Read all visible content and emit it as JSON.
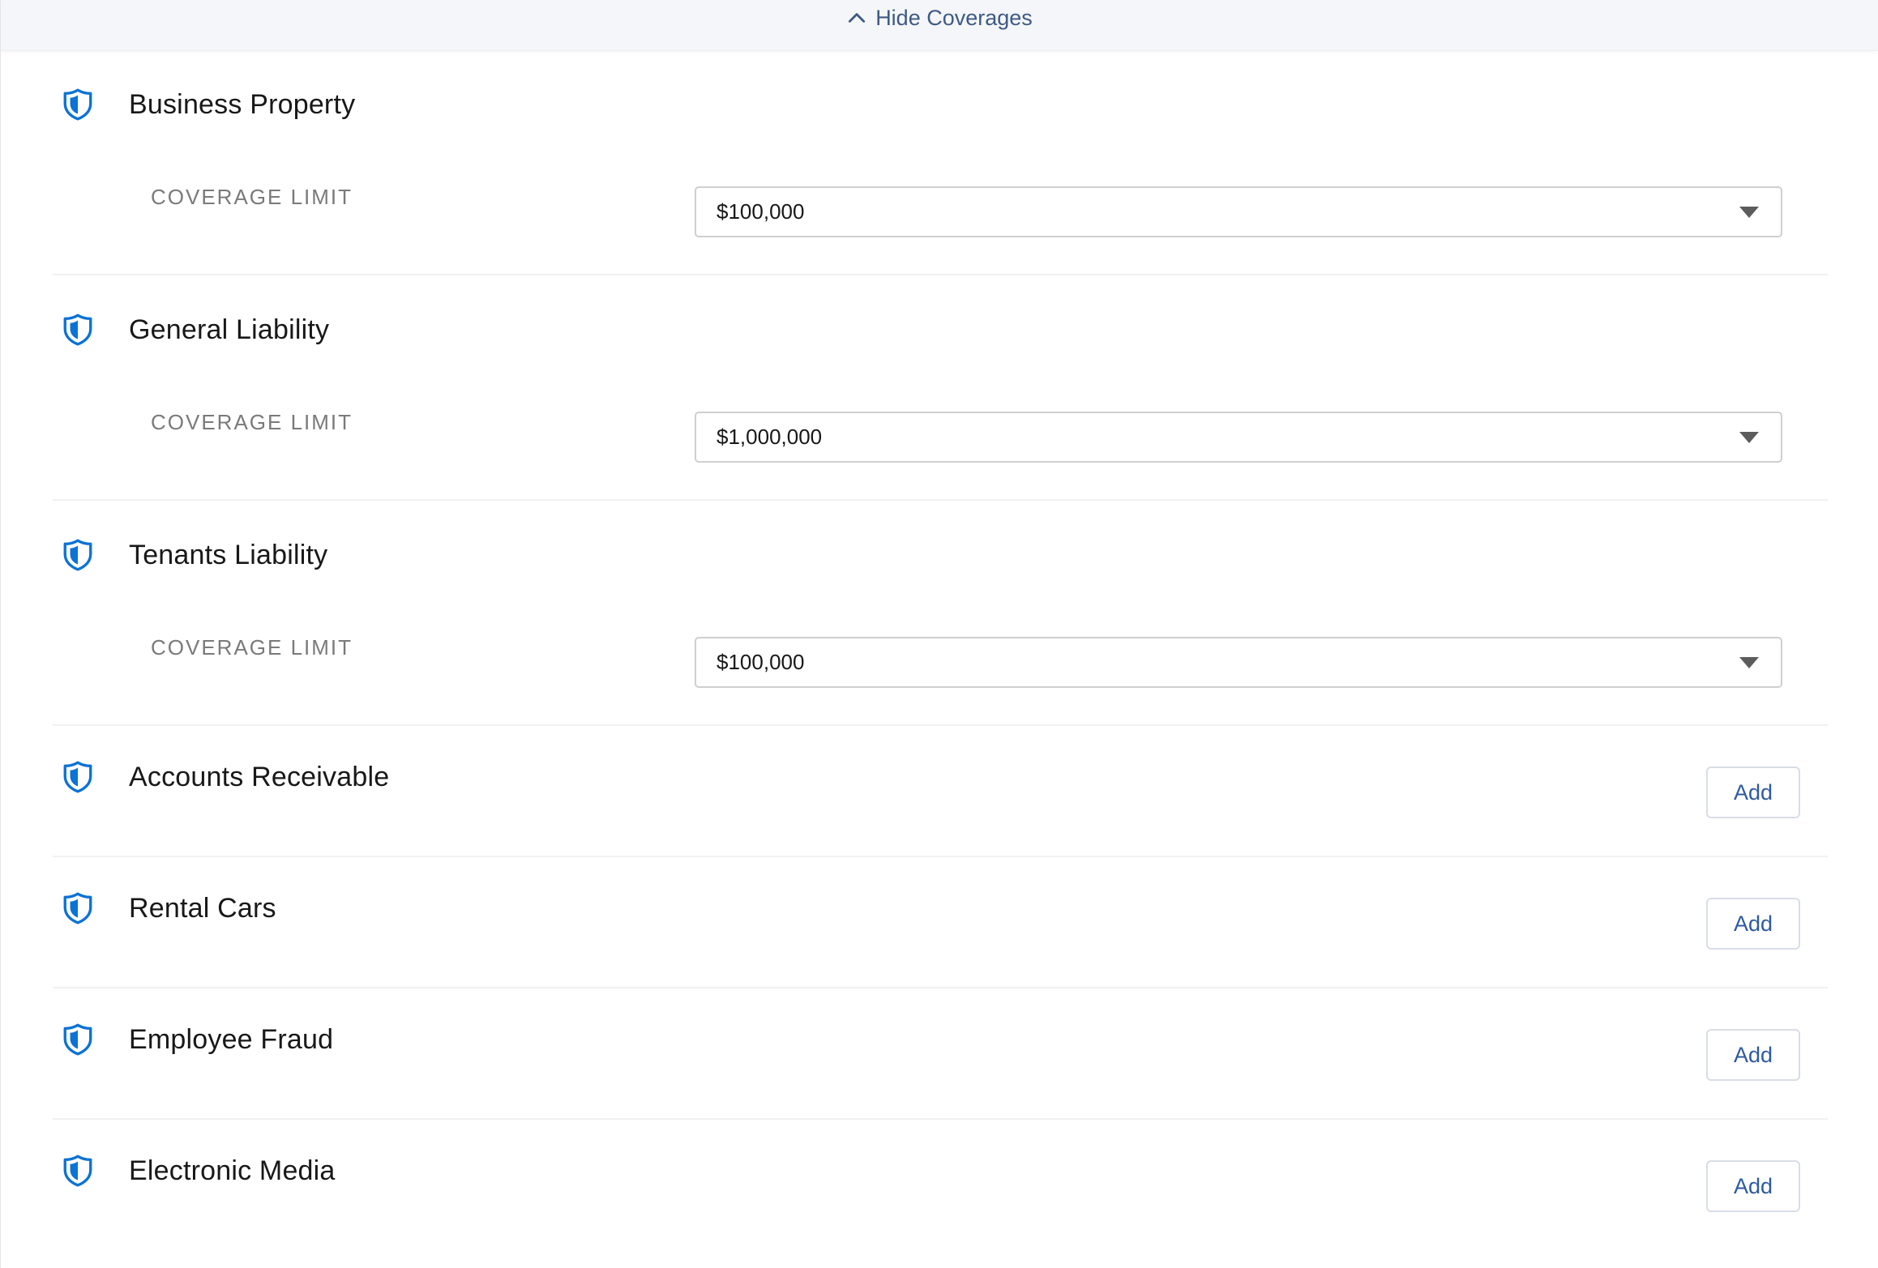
{
  "toggle": {
    "label": "Hide Coverages",
    "icon": "chevron-up-icon"
  },
  "colors": {
    "shield": "#0b72d6",
    "link": "#3e5a84",
    "button_text": "#2e5aa0"
  },
  "coverages": [
    {
      "name": "Business Property",
      "limit_label": "COVERAGE LIMIT",
      "limit_value": "$100,000"
    },
    {
      "name": "General Liability",
      "limit_label": "COVERAGE LIMIT",
      "limit_value": "$1,000,000"
    },
    {
      "name": "Tenants Liability",
      "limit_label": "COVERAGE LIMIT",
      "limit_value": "$100,000"
    },
    {
      "name": "Accounts Receivable",
      "action_label": "Add"
    },
    {
      "name": "Rental Cars",
      "action_label": "Add"
    },
    {
      "name": "Employee Fraud",
      "action_label": "Add"
    },
    {
      "name": "Electronic Media",
      "action_label": "Add"
    }
  ]
}
